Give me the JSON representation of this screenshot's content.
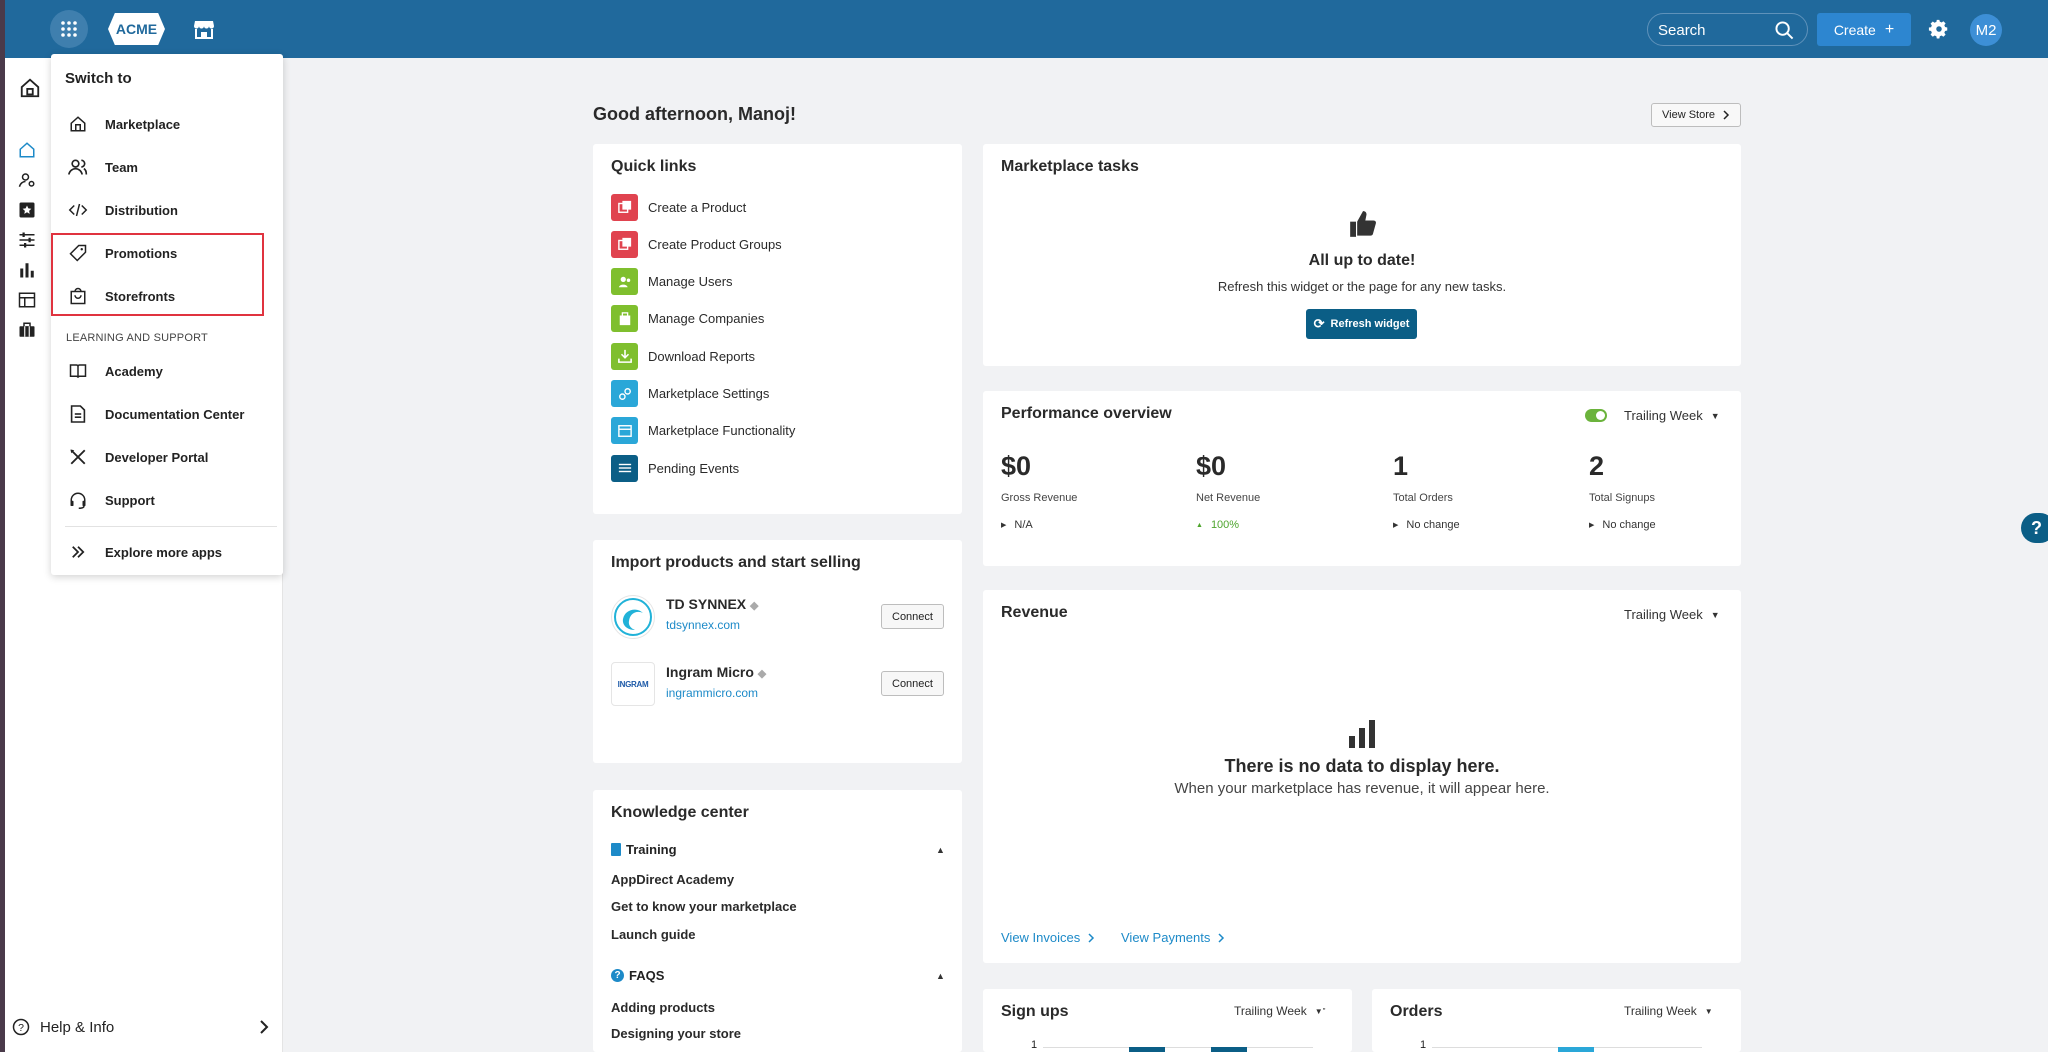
{
  "topbar": {
    "logo_text": "ACME",
    "search_placeholder": "Search",
    "create_label": "Create",
    "avatar_initials": "M2"
  },
  "sidebar": {
    "help_label": "Help & Info"
  },
  "switch_panel": {
    "title": "Switch to",
    "apps": [
      {
        "label": "Marketplace",
        "icon": "marketplace-icon"
      },
      {
        "label": "Team",
        "icon": "team-icon"
      },
      {
        "label": "Distribution",
        "icon": "code-icon"
      },
      {
        "label": "Promotions",
        "icon": "tag-icon"
      },
      {
        "label": "Storefronts",
        "icon": "bag-icon"
      }
    ],
    "section_label": "LEARNING AND SUPPORT",
    "support": [
      {
        "label": "Academy",
        "icon": "book-icon"
      },
      {
        "label": "Documentation Center",
        "icon": "document-icon"
      },
      {
        "label": "Developer Portal",
        "icon": "tools-icon"
      },
      {
        "label": "Support",
        "icon": "headset-icon"
      }
    ],
    "explore_label": "Explore more apps"
  },
  "main": {
    "greeting": "Good afternoon, Manoj!",
    "view_store_label": "View Store",
    "quick_links": {
      "title": "Quick links",
      "items": [
        {
          "label": "Create a Product",
          "color": "#e0434f"
        },
        {
          "label": "Create Product Groups",
          "color": "#e0434f"
        },
        {
          "label": "Manage Users",
          "color": "#7fbf2e"
        },
        {
          "label": "Manage Companies",
          "color": "#7fbf2e"
        },
        {
          "label": "Download Reports",
          "color": "#7fbf2e"
        },
        {
          "label": "Marketplace Settings",
          "color": "#2aa7d8"
        },
        {
          "label": "Marketplace Functionality",
          "color": "#2aa7d8"
        },
        {
          "label": "Pending Events",
          "color": "#0b5e86"
        }
      ]
    },
    "import": {
      "title": "Import products and start selling",
      "distributors": [
        {
          "name": "TD SYNNEX",
          "url": "tdsynnex.com",
          "connect_label": "Connect"
        },
        {
          "name": "Ingram Micro",
          "url": "ingrammicro.com",
          "connect_label": "Connect",
          "logo_text": "INGRAM"
        }
      ]
    },
    "knowledge": {
      "title": "Knowledge center",
      "training_label": "Training",
      "training_links": [
        "AppDirect Academy",
        "Get to know your marketplace",
        "Launch guide"
      ],
      "faqs_label": "FAQS",
      "faq_links": [
        "Adding products",
        "Designing your store"
      ]
    },
    "tasks": {
      "title": "Marketplace tasks",
      "status_title": "All up to date!",
      "status_text": "Refresh this widget or the page for any new tasks.",
      "refresh_label": "Refresh widget"
    },
    "performance": {
      "title": "Performance overview",
      "period": "Trailing Week",
      "metrics": [
        {
          "value": "$0",
          "label": "Gross Revenue",
          "change": "N/A"
        },
        {
          "value": "$0",
          "label": "Net Revenue",
          "change": "100%"
        },
        {
          "value": "1",
          "label": "Total Orders",
          "change": "No change"
        },
        {
          "value": "2",
          "label": "Total Signups",
          "change": "No change"
        }
      ]
    },
    "revenue": {
      "title": "Revenue",
      "period": "Trailing Week",
      "empty_title": "There is no data to display here.",
      "empty_text": "When your marketplace has revenue, it will appear here.",
      "view_invoices": "View Invoices",
      "view_payments": "View Payments"
    },
    "signups": {
      "title": "Sign ups",
      "period": "Trailing Week",
      "y_tick": "1"
    },
    "orders": {
      "title": "Orders",
      "period": "Trailing Week",
      "y_tick": "1"
    }
  },
  "help_bubble": "?"
}
